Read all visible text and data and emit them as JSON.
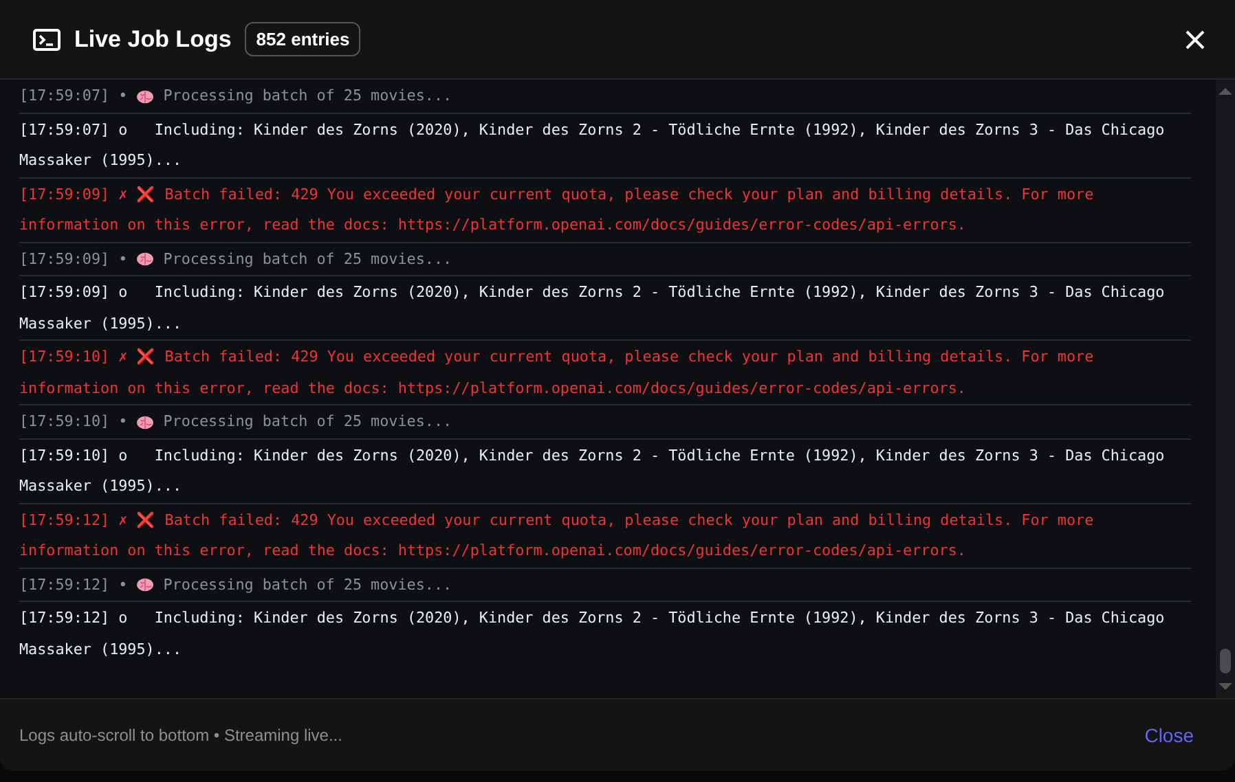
{
  "header": {
    "title": "Live Job Logs",
    "count": "852 entries"
  },
  "logs": [
    {
      "kind": "info",
      "time": "[17:59:07]",
      "mark": "•",
      "text": "Processing batch of 25 movies..."
    },
    {
      "kind": "detail",
      "time": "[17:59:07]",
      "mark": "o",
      "text": "Including: Kinder des Zorns (2020), Kinder des Zorns 2 - Tödliche Ernte (1992), Kinder des Zorns 3 - Das Chicago Massaker (1995)..."
    },
    {
      "kind": "error",
      "time": "[17:59:09]",
      "mark": "✗",
      "text": "❌ Batch failed: 429 You exceeded your current quota, please check your plan and billing details. For more information on this error, read the docs: https://platform.openai.com/docs/guides/error-codes/api-errors."
    },
    {
      "kind": "info",
      "time": "[17:59:09]",
      "mark": "•",
      "text": "Processing batch of 25 movies..."
    },
    {
      "kind": "detail",
      "time": "[17:59:09]",
      "mark": "o",
      "text": "Including: Kinder des Zorns (2020), Kinder des Zorns 2 - Tödliche Ernte (1992), Kinder des Zorns 3 - Das Chicago Massaker (1995)..."
    },
    {
      "kind": "error",
      "time": "[17:59:10]",
      "mark": "✗",
      "text": "❌ Batch failed: 429 You exceeded your current quota, please check your plan and billing details. For more information on this error, read the docs: https://platform.openai.com/docs/guides/error-codes/api-errors."
    },
    {
      "kind": "info",
      "time": "[17:59:10]",
      "mark": "•",
      "text": "Processing batch of 25 movies..."
    },
    {
      "kind": "detail",
      "time": "[17:59:10]",
      "mark": "o",
      "text": "Including: Kinder des Zorns (2020), Kinder des Zorns 2 - Tödliche Ernte (1992), Kinder des Zorns 3 - Das Chicago Massaker (1995)..."
    },
    {
      "kind": "error",
      "time": "[17:59:12]",
      "mark": "✗",
      "text": "❌ Batch failed: 429 You exceeded your current quota, please check your plan and billing details. For more information on this error, read the docs: https://platform.openai.com/docs/guides/error-codes/api-errors."
    },
    {
      "kind": "info",
      "time": "[17:59:12]",
      "mark": "•",
      "text": "Processing batch of 25 movies..."
    },
    {
      "kind": "detail",
      "time": "[17:59:12]",
      "mark": "o",
      "text": "Including: Kinder des Zorns (2020), Kinder des Zorns 2 - Tödliche Ernte (1992), Kinder des Zorns 3 - Das Chicago Massaker (1995)..."
    }
  ],
  "footer": {
    "note": "Logs auto-scroll to bottom • Streaming live...",
    "close": "Close"
  }
}
